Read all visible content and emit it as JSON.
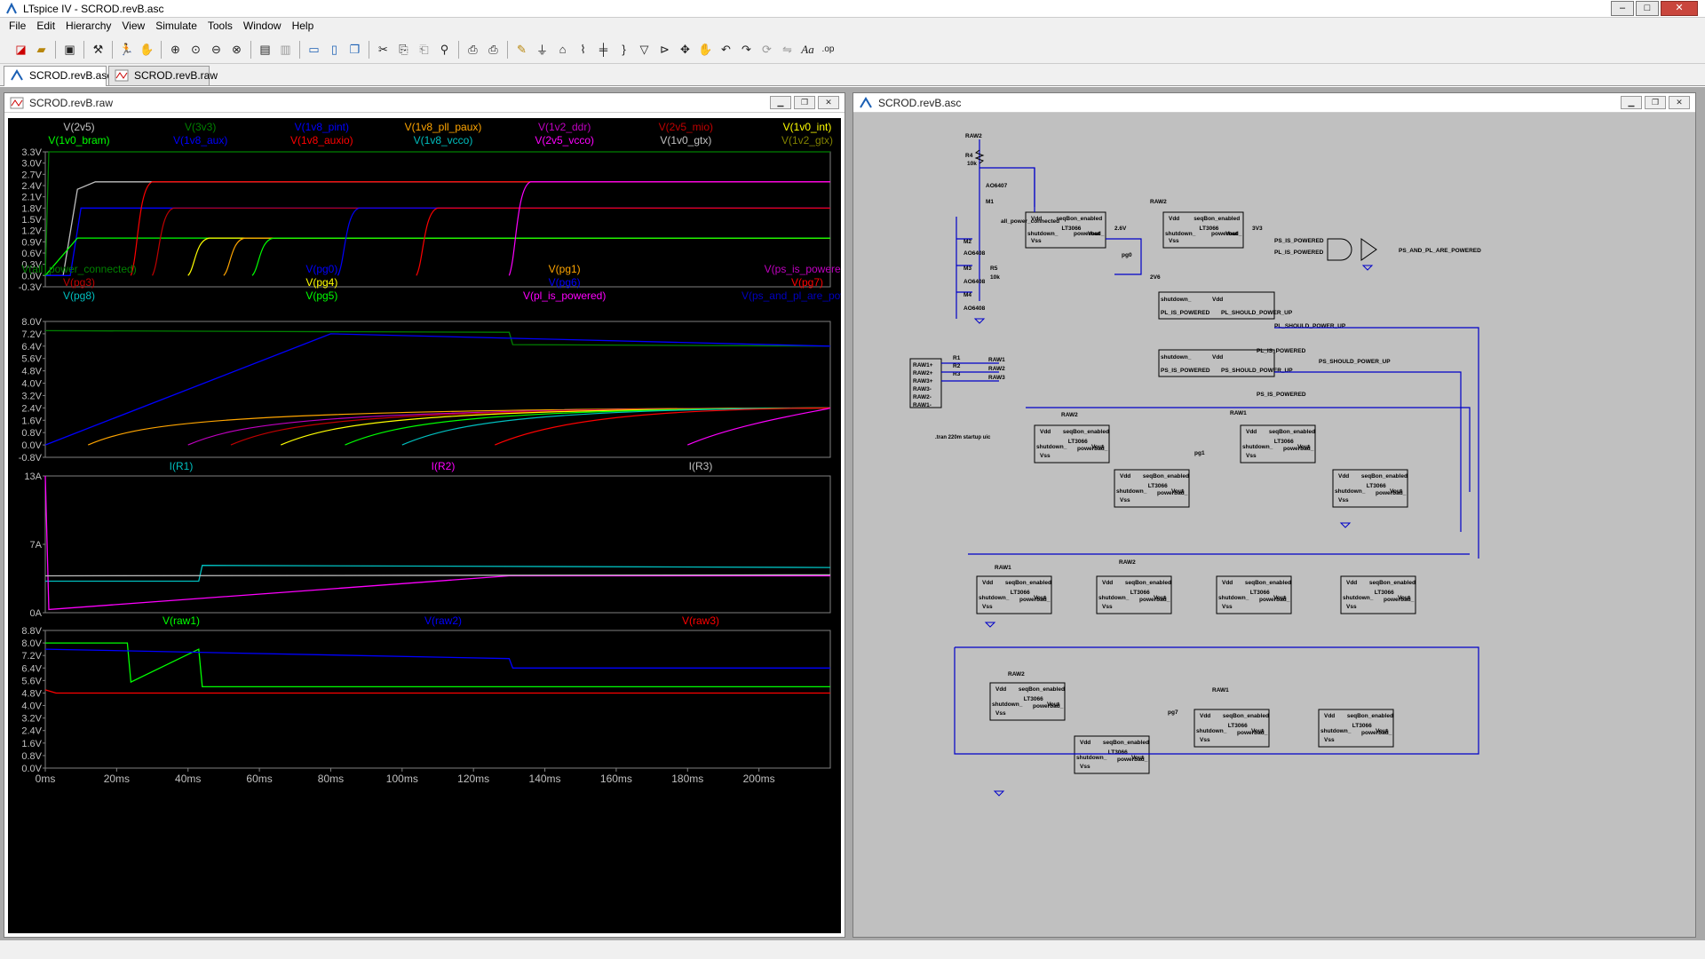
{
  "app": {
    "title": "LTspice IV - SCROD.revB.asc",
    "menus": [
      "File",
      "Edit",
      "Hierarchy",
      "View",
      "Simulate",
      "Tools",
      "Window",
      "Help"
    ]
  },
  "tabs": [
    {
      "label": "SCROD.revB.asc"
    },
    {
      "label": "SCROD.revB.raw"
    }
  ],
  "waveform": {
    "title": "SCROD.revB.raw",
    "pane1_traces": [
      {
        "name": "V(2v5)",
        "color": "#c0c0c0"
      },
      {
        "name": "V(3v3)",
        "color": "#008000"
      },
      {
        "name": "V(1v8_pint)",
        "color": "#0000ff"
      },
      {
        "name": "V(1v8_pll_paux)",
        "color": "#ffa500"
      },
      {
        "name": "V(1v2_ddr)",
        "color": "#c000c0"
      },
      {
        "name": "V(2v5_mio)",
        "color": "#c00000"
      },
      {
        "name": "V(1v0_int)",
        "color": "#ffff00"
      },
      {
        "name": "V(1v0_bram)",
        "color": "#00ff00"
      },
      {
        "name": "V(1v8_aux)",
        "color": "#0000ff"
      },
      {
        "name": "V(1v8_auxio)",
        "color": "#ff0000"
      },
      {
        "name": "V(1v8_vcco)",
        "color": "#00bfbf"
      },
      {
        "name": "V(2v5_vcco)",
        "color": "#ff00ff"
      },
      {
        "name": "V(1v0_gtx)",
        "color": "#c0c0c0"
      },
      {
        "name": "V(1v2_gtx)",
        "color": "#808000"
      }
    ],
    "pane1_yticks": [
      "3.3V",
      "3.0V",
      "2.7V",
      "2.4V",
      "2.1V",
      "1.8V",
      "1.5V",
      "1.2V",
      "0.9V",
      "0.6V",
      "0.3V",
      "0.0V",
      "-0.3V"
    ],
    "pane2_traces": [
      {
        "name": "V(all_power_connected)",
        "color": "#008000"
      },
      {
        "name": "V(pg0)",
        "color": "#0000ff"
      },
      {
        "name": "V(pg1)",
        "color": "#ffa500"
      },
      {
        "name": "V(ps_is_powered)",
        "color": "#c000c0"
      },
      {
        "name": "V(pg3)",
        "color": "#c00000"
      },
      {
        "name": "V(pg4)",
        "color": "#ffff00"
      },
      {
        "name": "V(pg6)",
        "color": "#0000ff"
      },
      {
        "name": "V(pg7)",
        "color": "#ff0000"
      },
      {
        "name": "V(pg8)",
        "color": "#00bfbf"
      },
      {
        "name": "V(pg5)",
        "color": "#00ff00"
      },
      {
        "name": "V(pl_is_powered)",
        "color": "#ff00ff"
      },
      {
        "name": "V(ps_and_pl_are_powered)",
        "color": "#0000c0"
      }
    ],
    "pane2_yticks": [
      "8.0V",
      "7.2V",
      "6.4V",
      "5.6V",
      "4.8V",
      "4.0V",
      "3.2V",
      "2.4V",
      "1.6V",
      "0.8V",
      "0.0V",
      "-0.8V"
    ],
    "pane3_traces": [
      {
        "name": "I(R1)",
        "color": "#00bfbf"
      },
      {
        "name": "I(R2)",
        "color": "#ff00ff"
      },
      {
        "name": "I(R3)",
        "color": "#c0c0c0"
      }
    ],
    "pane3_yticks": [
      "13A",
      "7A",
      "0A"
    ],
    "pane4_traces": [
      {
        "name": "V(raw1)",
        "color": "#00ff00"
      },
      {
        "name": "V(raw2)",
        "color": "#0000ff"
      },
      {
        "name": "V(raw3)",
        "color": "#ff0000"
      }
    ],
    "pane4_yticks": [
      "8.8V",
      "8.0V",
      "7.2V",
      "6.4V",
      "5.6V",
      "4.8V",
      "4.0V",
      "3.2V",
      "2.4V",
      "1.6V",
      "0.8V",
      "0.0V"
    ],
    "xticks": [
      "0ms",
      "20ms",
      "40ms",
      "60ms",
      "80ms",
      "100ms",
      "120ms",
      "140ms",
      "160ms",
      "180ms",
      "200ms"
    ]
  },
  "chart_data": [
    {
      "type": "line",
      "ylim": [
        -0.3,
        3.3
      ],
      "xlim": [
        0,
        220
      ],
      "x_unit": "ms",
      "series": [
        {
          "name": "V(3v3)",
          "points": [
            [
              0,
              0
            ],
            [
              1,
              3.3
            ],
            [
              220,
              3.3
            ]
          ]
        },
        {
          "name": "V(2v5)",
          "points": [
            [
              0,
              0
            ],
            [
              5,
              0
            ],
            [
              9,
              2.3
            ],
            [
              14,
              2.5
            ],
            [
              220,
              2.5
            ]
          ]
        },
        {
          "name": "V(1v8_aux)",
          "points": [
            [
              0,
              0
            ],
            [
              7,
              0
            ],
            [
              10,
              1.8
            ],
            [
              220,
              1.8
            ]
          ]
        },
        {
          "name": "V(1v0_bram)",
          "points": [
            [
              0,
              0
            ],
            [
              9,
              1.0
            ],
            [
              220,
              1.0
            ]
          ]
        }
      ]
    },
    {
      "type": "line",
      "ylim": [
        -0.8,
        8.0
      ],
      "xlim": [
        0,
        220
      ],
      "x_unit": "ms",
      "series": [
        {
          "name": "V(all_power_connected)",
          "points": [
            [
              0,
              7.4
            ],
            [
              130,
              7.3
            ],
            [
              131,
              6.5
            ],
            [
              220,
              6.4
            ]
          ]
        },
        {
          "name": "V(pg0)",
          "points": [
            [
              0,
              0
            ],
            [
              80,
              7.2
            ],
            [
              220,
              6.4
            ]
          ]
        }
      ]
    },
    {
      "type": "line",
      "ylim": [
        0,
        13
      ],
      "xlim": [
        0,
        220
      ],
      "x_unit": "ms",
      "series": [
        {
          "name": "I(R1)",
          "points": [
            [
              0,
              3.0
            ],
            [
              43,
              3.0
            ],
            [
              44,
              4.5
            ],
            [
              220,
              4.3
            ]
          ]
        },
        {
          "name": "I(R2)",
          "points": [
            [
              0,
              13
            ],
            [
              1,
              0.3
            ],
            [
              130,
              3.5
            ],
            [
              220,
              3.5
            ]
          ]
        },
        {
          "name": "I(R3)",
          "points": [
            [
              0,
              3.5
            ],
            [
              220,
              3.6
            ]
          ]
        }
      ]
    },
    {
      "type": "line",
      "ylim": [
        0,
        8.8
      ],
      "xlim": [
        0,
        220
      ],
      "x_unit": "ms",
      "series": [
        {
          "name": "V(raw1)",
          "points": [
            [
              0,
              8.0
            ],
            [
              23,
              8.0
            ],
            [
              24,
              5.5
            ],
            [
              43,
              7.6
            ],
            [
              44,
              5.2
            ],
            [
              220,
              5.2
            ]
          ]
        },
        {
          "name": "V(raw2)",
          "points": [
            [
              0,
              7.6
            ],
            [
              130,
              7.0
            ],
            [
              131,
              6.4
            ],
            [
              220,
              6.4
            ]
          ]
        },
        {
          "name": "V(raw3)",
          "points": [
            [
              0,
              5.0
            ],
            [
              3,
              4.8
            ],
            [
              220,
              4.8
            ]
          ]
        }
      ]
    }
  ],
  "schematic": {
    "title": "SCROD.revB.asc",
    "labels": {
      "raw2": "RAW2",
      "r4": "R4",
      "r4v": "10k",
      "q": "AO6407",
      "m1": "M1",
      "apc": "all_power_connected",
      "m2": "M2",
      "m3": "M3",
      "m4": "M4",
      "q2": "AO6408",
      "r5": "R5",
      "r5v": "10k",
      "tran": ".tran 220m startup uic",
      "pg0": "pg0",
      "v2v6": "2V6",
      "pl_is": "PL_IS_POWERED",
      "ps_is": "PS_IS_POWERED",
      "plsp": "PL_SHOULD_POWER_UP",
      "pssp": "PS_SHOULD_POWER_UP",
      "pspl": "PS_AND_PL_ARE_POWERED",
      "raw1": "RAW1",
      "pg1": "pg1",
      "pg7": "pg7"
    },
    "chip": {
      "vdd": "Vdd",
      "sel": "seqBon_enabled",
      "part": "LT3066",
      "shut": "shutdown_",
      "vout": "Vout",
      "vss": "Vss",
      "pb": "powerbad_"
    }
  }
}
